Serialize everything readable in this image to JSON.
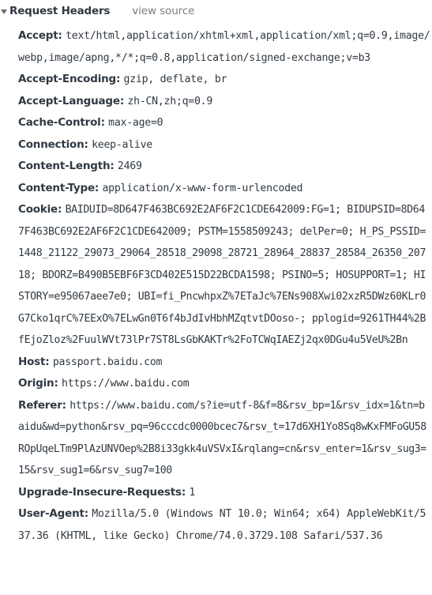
{
  "section": {
    "title": "Request Headers",
    "toggle_icon": "disclosure-triangle-down",
    "view_source_label": "view source"
  },
  "headers": [
    {
      "name": "Accept:",
      "value": "text/html,application/xhtml+xml,application/xml;q=0.9,image/webp,image/apng,*/*;q=0.8,application/signed-exchange;v=b3"
    },
    {
      "name": "Accept-Encoding:",
      "value": "gzip, deflate, br"
    },
    {
      "name": "Accept-Language:",
      "value": "zh-CN,zh;q=0.9"
    },
    {
      "name": "Cache-Control:",
      "value": "max-age=0"
    },
    {
      "name": "Connection:",
      "value": "keep-alive"
    },
    {
      "name": "Content-Length:",
      "value": "2469"
    },
    {
      "name": "Content-Type:",
      "value": "application/x-www-form-urlencoded"
    },
    {
      "name": "Cookie:",
      "value": "BAIDUID=8D647F463BC692E2AF6F2C1CDE642009:FG=1; BIDUPSID=8D647F463BC692E2AF6F2C1CDE642009; PSTM=1558509243; delPer=0; H_PS_PSSID=1448_21122_29073_29064_28518_29098_28721_28964_28837_28584_26350_20718; BDORZ=B490B5EBF6F3CD402E515D22BCDA1598; PSINO=5; HOSUPPORT=1; HISTORY=e95067aee7e0; UBI=fi_PncwhpxZ%7ETaJc%7ENs908Xwi02xzR5DWz60KLr0G7Cko1qrC%7EExO%7ELwGn0T6f4bJdIvHbhMZqtvtDOoso-; pplogid=9261TH44%2BfEjoZloz%2FuulWVt73lPr7ST8LsGbKAKTr%2FoTCWqIAEZj2qx0DGu4u5VeU%2Bn"
    },
    {
      "name": "Host:",
      "value": "passport.baidu.com"
    },
    {
      "name": "Origin:",
      "value": "https://www.baidu.com"
    },
    {
      "name": "Referer:",
      "value": "https://www.baidu.com/s?ie=utf-8&f=8&rsv_bp=1&rsv_idx=1&tn=baidu&wd=python&rsv_pq=96cccdc0000bcec7&rsv_t=17d6XH1Yo8Sq8wKxFMFoGU58ROpUqeLTm9PlAzUNVOep%2B8i33gkk4uVSVxI&rqlang=cn&rsv_enter=1&rsv_sug3=15&rsv_sug1=6&rsv_sug7=100"
    },
    {
      "name": "Upgrade-Insecure-Requests:",
      "value": "1"
    },
    {
      "name": "User-Agent:",
      "value": "Mozilla/5.0 (Windows NT 10.0; Win64; x64) AppleWebKit/537.36 (KHTML, like Gecko) Chrome/74.0.3729.108 Safari/537.36"
    }
  ]
}
